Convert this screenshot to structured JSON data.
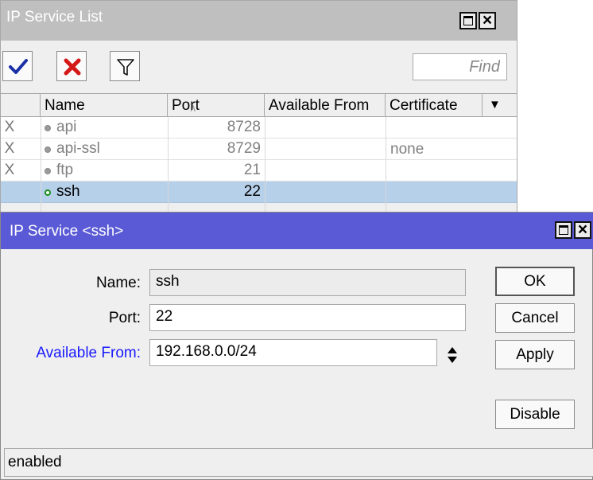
{
  "list_window": {
    "title": "IP Service List",
    "find_placeholder": "Find",
    "columns": [
      "Name",
      "Port",
      "Available From",
      "Certificate"
    ],
    "rows": [
      {
        "flag": "X",
        "name": "api",
        "port": "8728",
        "available_from": "",
        "certificate": ""
      },
      {
        "flag": "X",
        "name": "api-ssl",
        "port": "8729",
        "available_from": "",
        "certificate": "none"
      },
      {
        "flag": "X",
        "name": "ftp",
        "port": "21",
        "available_from": "",
        "certificate": ""
      },
      {
        "flag": "",
        "name": "ssh",
        "port": "22",
        "available_from": "",
        "certificate": ""
      }
    ]
  },
  "dialog": {
    "title": "IP Service <ssh>",
    "name_label": "Name:",
    "name_value": "ssh",
    "port_label": "Port:",
    "port_value": "22",
    "available_from_label": "Available From:",
    "available_from_value": "192.168.0.0/24",
    "buttons": {
      "ok": "OK",
      "cancel": "Cancel",
      "apply": "Apply",
      "disable": "Disable"
    },
    "status": "enabled"
  },
  "colors": {
    "list_title_bar": "#bfbfbf",
    "dialog_title_bar": "#5a5ad6",
    "selected_row": "#b6d0ea",
    "available_from_label": "#1a1aff",
    "enabled_dot": "#1a8f1a"
  },
  "icons": [
    "check-icon",
    "cross-icon",
    "filter-icon",
    "maximize-icon",
    "close-icon",
    "sort-icon",
    "column-menu-icon",
    "updown-icon",
    "status-dot-icon"
  ]
}
